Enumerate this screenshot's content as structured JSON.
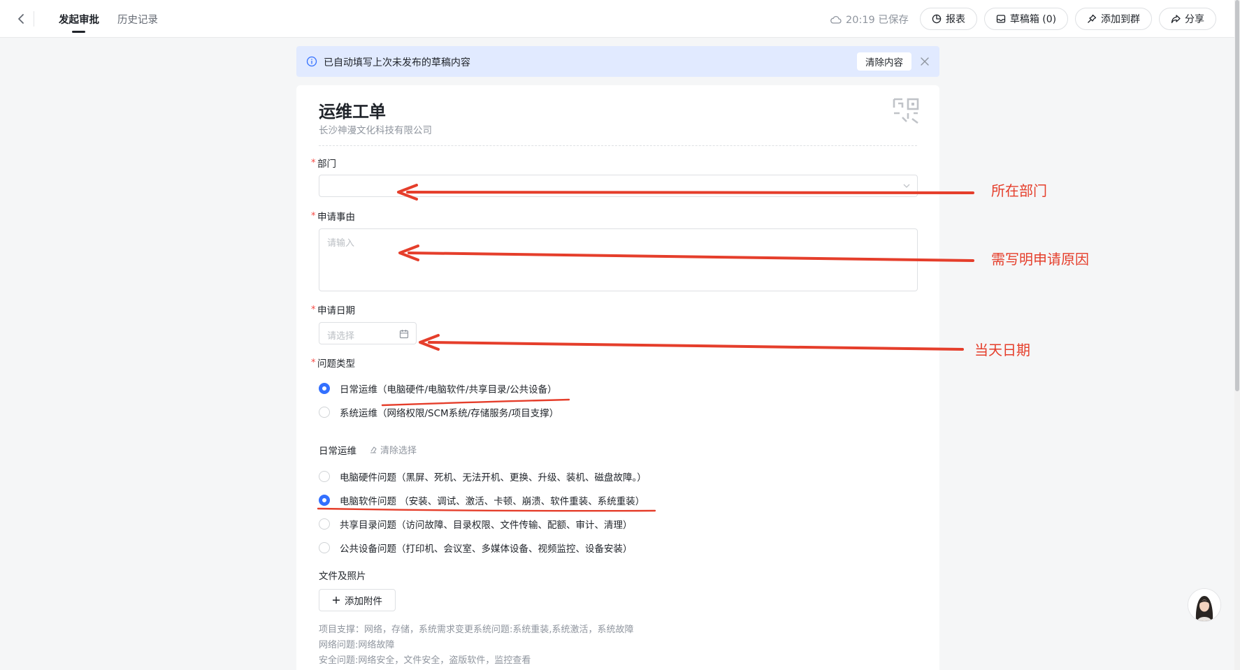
{
  "topbar": {
    "tabs": [
      "发起审批",
      "历史记录"
    ],
    "save_status": "20:19 已保存",
    "buttons": [
      "报表",
      "草稿箱 (0)",
      "添加到群",
      "分享"
    ]
  },
  "banner": {
    "message": "已自动填写上次未发布的草稿内容",
    "clear_label": "清除内容"
  },
  "form": {
    "title": "运维工单",
    "company": "长沙神漫文化科技有限公司",
    "required_mark": "*",
    "department": {
      "label": "部门",
      "value": ""
    },
    "reason": {
      "label": "申请事由",
      "placeholder": "请输入"
    },
    "date": {
      "label": "申请日期",
      "placeholder": "请选择"
    },
    "issue_type": {
      "label": "问题类型",
      "options": [
        "日常运维（电脑硬件/电脑软件/共享目录/公共设备）",
        "系统运维（网络权限/SCM系统/存储服务/项目支撑）"
      ],
      "selected": 0
    },
    "daily": {
      "label": "日常运维",
      "clear_label": "清除选择",
      "options": [
        "电脑硬件问题（黑屏、死机、无法开机、更换、升级、装机、磁盘故障。）",
        "电脑软件问题 （安装、调试、激活、卡顿、崩溃、软件重装、系统重装）",
        "共享目录问题（访问故障、目录权限、文件传输、配额、审计、清理）",
        "公共设备问题（打印机、会议室、多媒体设备、视频监控、设备安装）"
      ],
      "selected": 1
    },
    "attachments": {
      "label": "文件及照片",
      "button": "添加附件"
    },
    "notes": [
      "项目支撑：网络，存储，系统需求变更系统问题:系统重装,系统激活，系统故障",
      "网络问题:网络故障",
      "安全问题:网络安全，文件安全，盗版软件，监控查看"
    ]
  },
  "annotations": [
    "所在部门",
    "需写明申请原因",
    "当天日期"
  ],
  "colors": {
    "accent": "#3370ff",
    "annotation": "#e53e2b",
    "banner_bg": "#e1eaff",
    "required": "#f54a45"
  }
}
